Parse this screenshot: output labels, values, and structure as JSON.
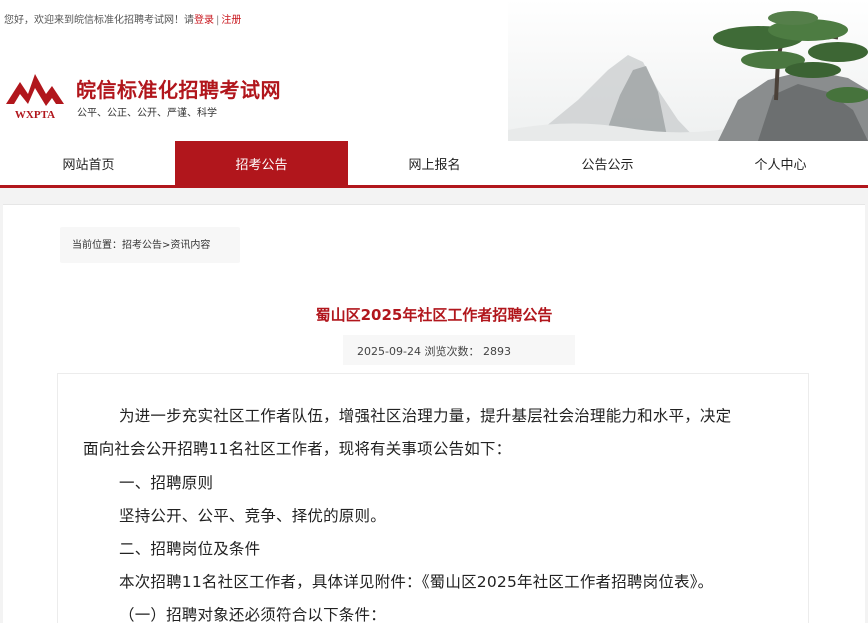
{
  "topbar": {
    "greeting": "您好，欢迎来到皖信标准化招聘考试网！请",
    "login": "登录",
    "separator": "|",
    "register": "注册"
  },
  "brand": {
    "logo_text": "WXPTA",
    "title": "皖信标准化招聘考试网",
    "slogan": "公平、公正、公开、严谨、科学",
    "accent": "#b1161c"
  },
  "nav": {
    "items": [
      {
        "label": "网站首页"
      },
      {
        "label": "招考公告"
      },
      {
        "label": "网上报名"
      },
      {
        "label": "公告公示"
      },
      {
        "label": "个人中心"
      }
    ],
    "active_index": 1
  },
  "breadcrumb": {
    "prefix": "当前位置：",
    "item1": "招考公告",
    "sep": ">",
    "item2": "资讯内容"
  },
  "article": {
    "title": "蜀山区2025年社区工作者招聘公告",
    "date": "2025-09-24",
    "views_label": "浏览次数：",
    "views": "2893",
    "paragraphs": [
      "为进一步充实社区工作者队伍，增强社区治理力量，提升基层社会治理能力和水平，决定",
      "面向社会公开招聘11名社区工作者，现将有关事项公告如下：",
      "一、招聘原则",
      "坚持公开、公平、竞争、择优的原则。",
      "二、招聘岗位及条件",
      "本次招聘11名社区工作者，具体详见附件：《蜀山区2025年社区工作者招聘岗位表》。",
      "（一）招聘对象还必须符合以下条件："
    ]
  }
}
